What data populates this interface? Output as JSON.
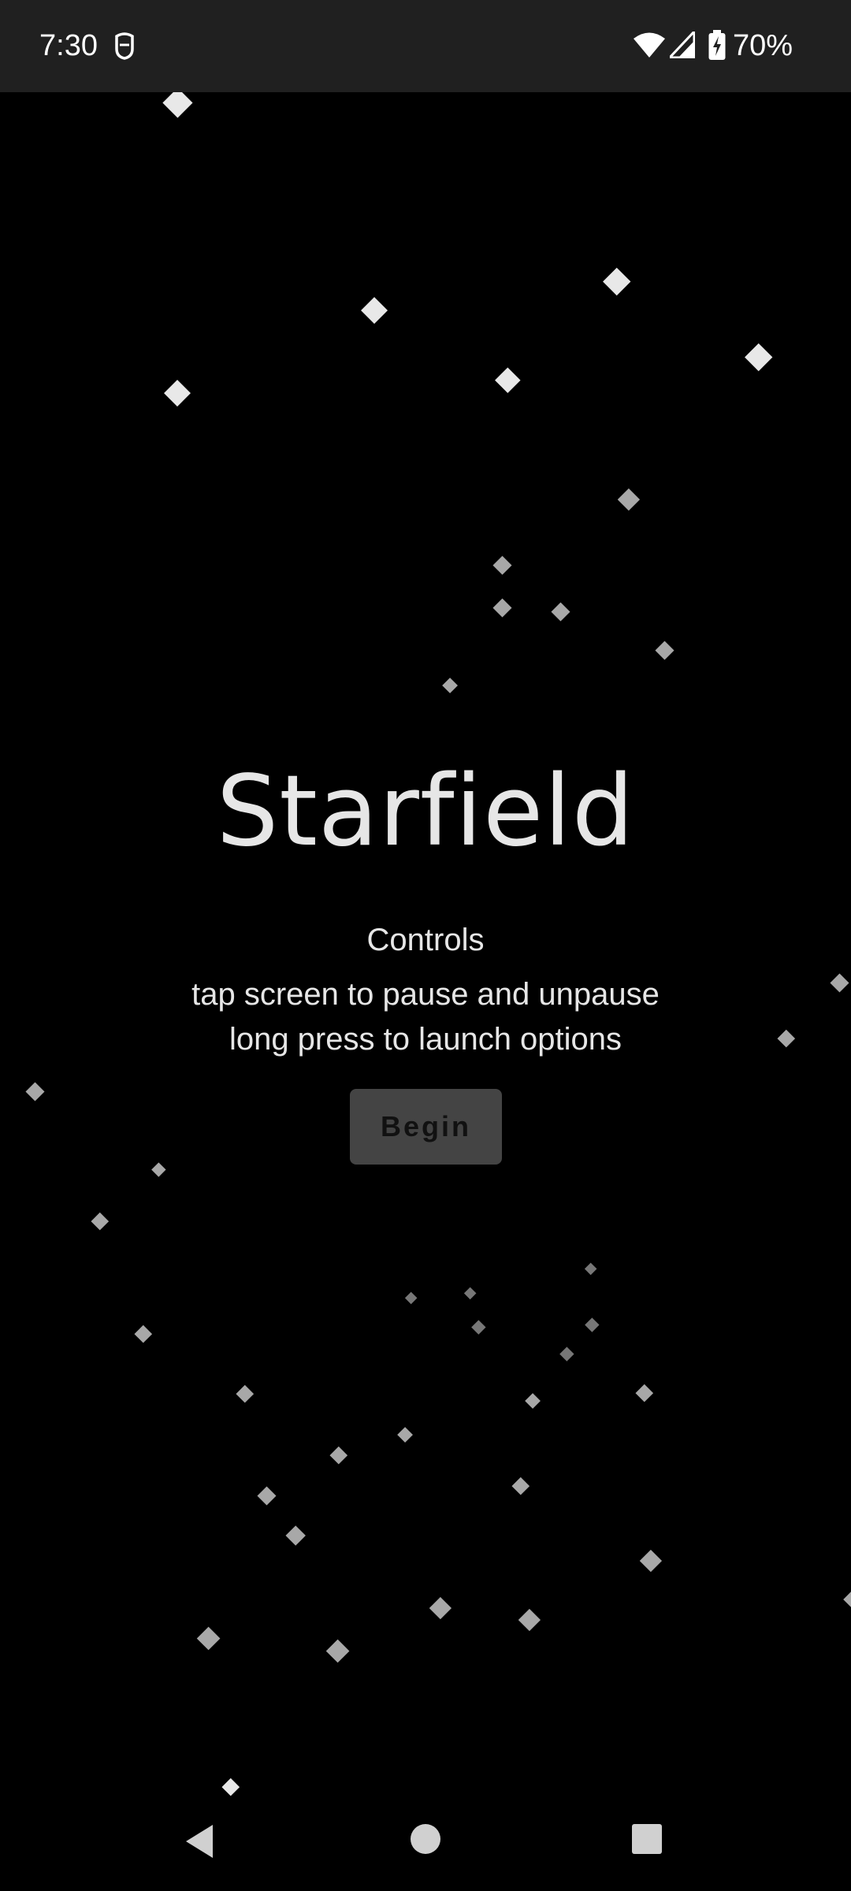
{
  "status_bar": {
    "time": "7:30",
    "battery_percent": "70%",
    "icons": [
      "shield-icon",
      "wifi-icon",
      "cellular-signal-icon",
      "battery-charging-icon"
    ]
  },
  "app": {
    "title": "Starfield",
    "controls_heading": "Controls",
    "controls_lines": [
      "tap screen to pause and unpause",
      "long press to launch options"
    ],
    "begin_label": "Begin"
  },
  "navigation_bar": {
    "buttons": [
      "back-button",
      "home-button",
      "recents-button"
    ]
  },
  "colors": {
    "background": "#000000",
    "status_bar_bg": "#202020",
    "text": "#e6e6e6",
    "button_bg": "#444444",
    "button_text": "#111111",
    "star_bright": "#e8e8e8",
    "star_mid": "#a8a8a8",
    "star_dim": "#777777"
  }
}
